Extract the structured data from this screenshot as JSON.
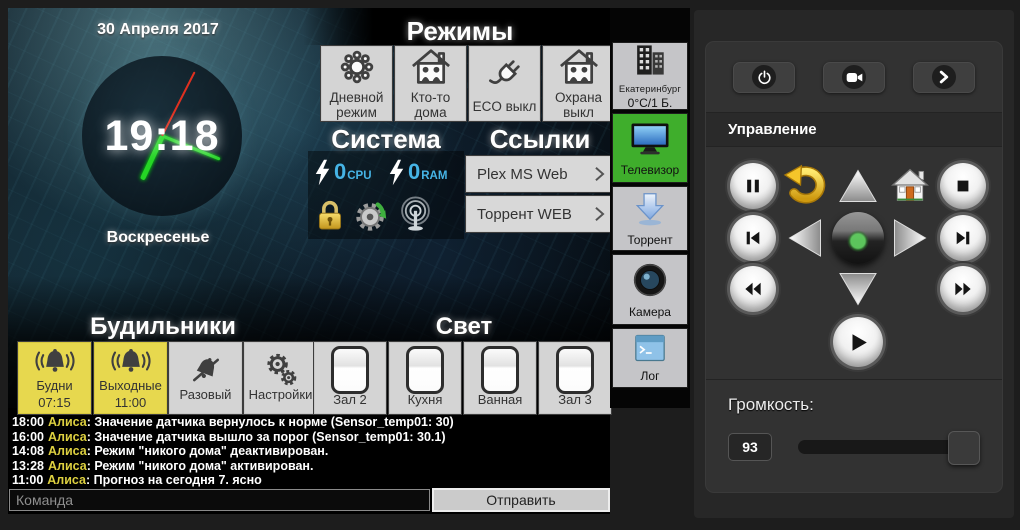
{
  "clock": {
    "date": "30 Апреля 2017",
    "time": "19:18",
    "weekday": "Воскресенье"
  },
  "modes": {
    "title": "Режимы",
    "buttons": [
      {
        "label": "Дневной режим",
        "icon": "sun-icon"
      },
      {
        "label": "Кто-то дома",
        "icon": "house-people-icon"
      },
      {
        "label": "ECO выкл",
        "icon": "plug-icon"
      },
      {
        "label": "Охрана выкл",
        "icon": "house-people-icon"
      }
    ]
  },
  "system": {
    "title": "Система",
    "cpu_value": "0",
    "cpu_unit": "CPU",
    "ram_value": "0",
    "ram_unit": "RAM"
  },
  "links": {
    "title": "Ссылки",
    "items": [
      {
        "label": "Plex MS Web"
      },
      {
        "label": "Торрент WEB"
      }
    ]
  },
  "alarms": {
    "title": "Будильники",
    "buttons": [
      {
        "line1": "Будни",
        "line2": "07:15",
        "active": true,
        "icon": "bell-ring-icon"
      },
      {
        "line1": "Выходные",
        "line2": "11:00",
        "active": true,
        "icon": "bell-ring-icon"
      },
      {
        "line1": "Разовый",
        "line2": "",
        "active": false,
        "icon": "bell-slash-icon"
      },
      {
        "line1": "Настройки",
        "line2": "",
        "active": false,
        "icon": "gears-icon"
      }
    ]
  },
  "light": {
    "title": "Свет",
    "buttons": [
      {
        "label": "Зал 2"
      },
      {
        "label": "Кухня"
      },
      {
        "label": "Ванная"
      },
      {
        "label": "Зал 3"
      }
    ]
  },
  "sidebar": {
    "items": [
      {
        "label": "Екатеринбург",
        "sublabel": "0°C/1 Б.",
        "icon": "city-buildings-icon"
      },
      {
        "label": "Телевизор",
        "selected": true,
        "icon": "tv-monitor-icon"
      },
      {
        "label": "Торрент",
        "icon": "download-arrow-icon"
      },
      {
        "label": "Камера",
        "icon": "camera-lens-icon"
      },
      {
        "label": "Лог",
        "icon": "terminal-icon"
      }
    ]
  },
  "log": {
    "entries": [
      {
        "time": "18:00",
        "author": "Алиса",
        "message": ": Значение датчика вернулось к норме (Sensor_temp01: 30)"
      },
      {
        "time": "16:00",
        "author": "Алиса",
        "message": ": Значение датчика вышло за порог (Sensor_temp01: 30.1)"
      },
      {
        "time": "14:08",
        "author": "Алиса",
        "message": ": Режим \"никого дома\" деактивирован."
      },
      {
        "time": "13:28",
        "author": "Алиса",
        "message": ": Режим \"никого дома\" активирован."
      },
      {
        "time": "11:00",
        "author": "Алиса",
        "message": ": Прогноз на сегодня 7. ясно"
      }
    ]
  },
  "command": {
    "placeholder": "Команда",
    "send_label": "Отправить"
  },
  "remote": {
    "header": "Управление",
    "volume_label": "Громкость:",
    "volume_value": "93"
  },
  "colors": {
    "accent_green": "#3fae2c",
    "alarm_yellow": "#e7d84e",
    "cpu_cyan": "#46b4e6",
    "selected_bg": "#3fae2c"
  }
}
